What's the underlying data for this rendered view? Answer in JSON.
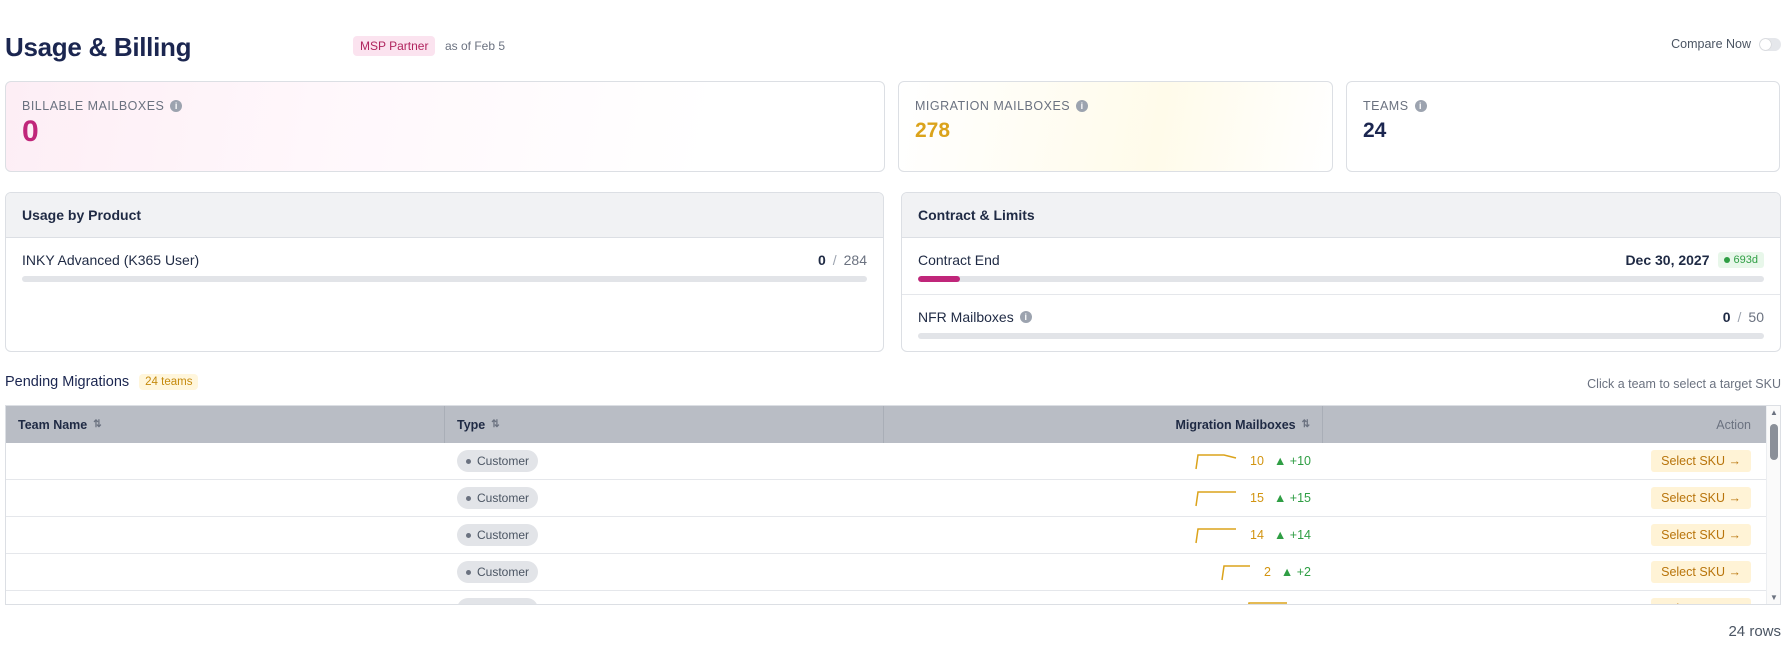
{
  "header": {
    "title": "Usage & Billing",
    "partner_badge": "MSP Partner",
    "as_of": "as of Feb 5",
    "compare_label": "Compare Now"
  },
  "stats": {
    "billable": {
      "label": "BILLABLE MAILBOXES",
      "value": "0"
    },
    "migration": {
      "label": "MIGRATION MAILBOXES",
      "value": "278"
    },
    "teams": {
      "label": "TEAMS",
      "value": "24"
    }
  },
  "usage_panel": {
    "title": "Usage by Product",
    "items": [
      {
        "name": "INKY Advanced (K365 User)",
        "used": "0",
        "total": "284",
        "fill_fraction": 0
      }
    ]
  },
  "contract_panel": {
    "title": "Contract & Limits",
    "contract_end": {
      "label": "Contract End",
      "date": "Dec 30, 2027",
      "days": "693d",
      "fill_fraction": 0.05
    },
    "nfr": {
      "label": "NFR Mailboxes",
      "used": "0",
      "total": "50",
      "fill_fraction": 0
    }
  },
  "pending": {
    "title": "Pending Migrations",
    "badge": "24 teams",
    "hint": "Click a team to select a target SKU",
    "columns": [
      "Team Name",
      "Type",
      "Migration Mailboxes",
      "Action"
    ],
    "rows": [
      {
        "type": "Customer",
        "mailboxes": "10",
        "delta": "▲ +10",
        "action": "Select SKU →"
      },
      {
        "type": "Customer",
        "mailboxes": "15",
        "delta": "▲ +15",
        "action": "Select SKU →"
      },
      {
        "type": "Customer",
        "mailboxes": "14",
        "delta": "▲ +14",
        "action": "Select SKU →"
      },
      {
        "type": "Customer",
        "mailboxes": "2",
        "delta": "▲ +2",
        "action": "Select SKU →"
      },
      {
        "type": "Customer",
        "mailboxes": "",
        "delta": "",
        "action": "Select SKU →"
      }
    ],
    "row_count": "24 rows"
  },
  "colors": {
    "brand_magenta": "#c0267a",
    "migration_amber": "#dba31b",
    "positive_green": "#2f9e44"
  }
}
